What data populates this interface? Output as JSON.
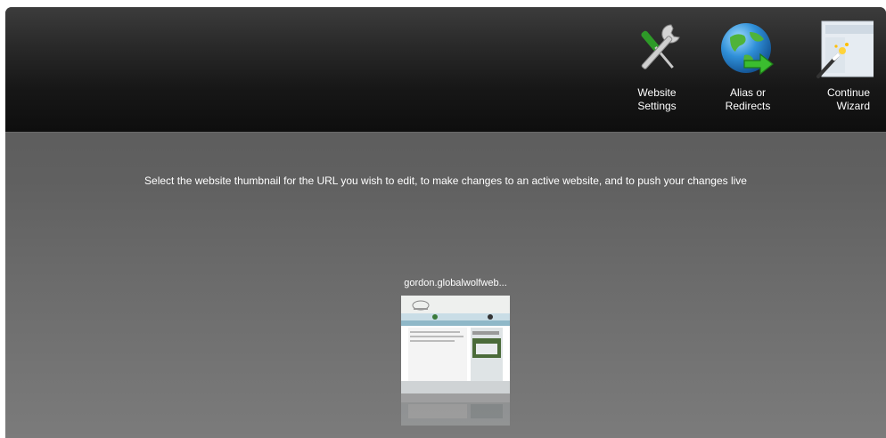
{
  "toolbar": {
    "items": [
      {
        "label_line1": "Website",
        "label_line2": "Settings",
        "icon": "wrench-screwdriver-icon"
      },
      {
        "label_line1": "Alias or",
        "label_line2": "Redirects",
        "icon": "globe-arrow-icon"
      },
      {
        "label_line1": "Continue",
        "label_line2": "Wizard",
        "icon": "wizard-wand-icon"
      }
    ]
  },
  "main": {
    "instruction": "Select the website thumbnail for the URL you wish to edit, to make changes to an active website, and to push your changes live",
    "websites": [
      {
        "name": "gordon.globalwolfweb...",
        "thumbnail": "website-thumbnail"
      }
    ]
  },
  "colors": {
    "header_bg": "#1a1a1a",
    "body_bg": "#616161",
    "text": "#ffffff",
    "icon_green": "#3a9a2e",
    "icon_blue": "#2f8fd8"
  }
}
